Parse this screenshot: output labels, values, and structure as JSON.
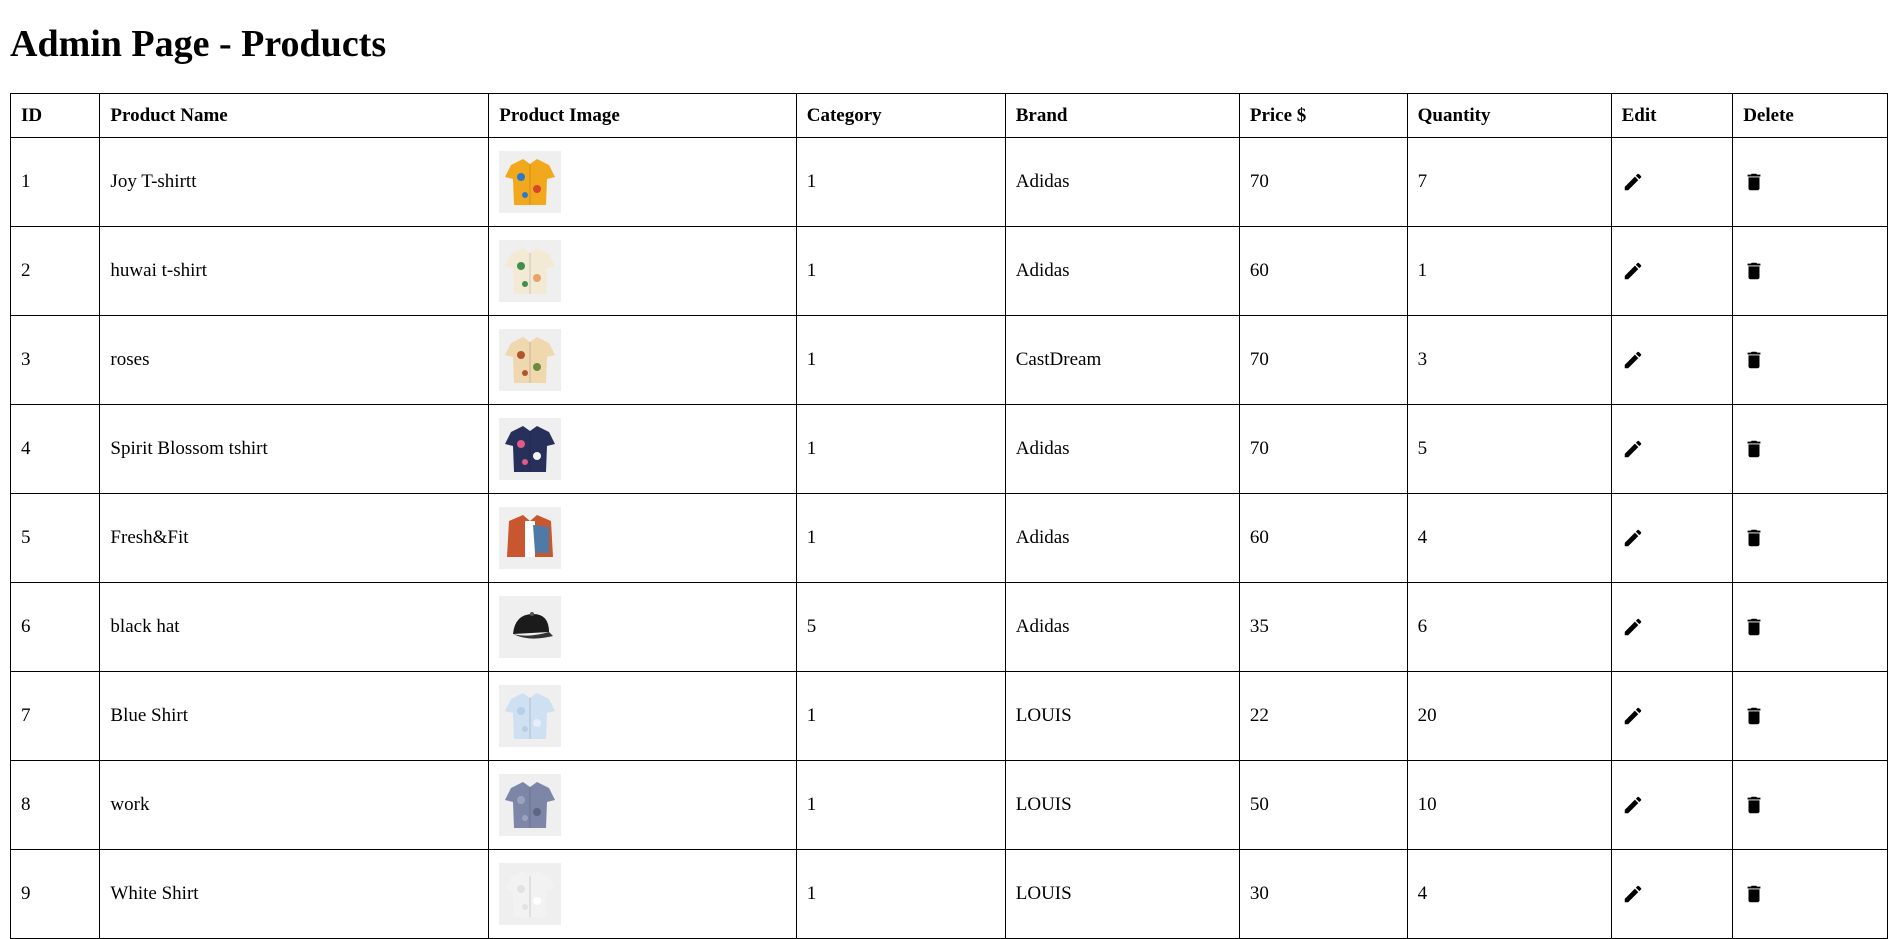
{
  "page_title": "Admin Page - Products",
  "table": {
    "headers": [
      "ID",
      "Product Name",
      "Product Image",
      "Category",
      "Brand",
      "Price $",
      "Quantity",
      "Edit",
      "Delete"
    ],
    "rows": [
      {
        "id": "1",
        "name": "Joy T-shirtt",
        "image": "colorful-print-shirt",
        "category": "1",
        "brand": "Adidas",
        "price": "70",
        "quantity": "7"
      },
      {
        "id": "2",
        "name": "huwai t-shirt",
        "image": "tropical-leaf-shirt",
        "category": "1",
        "brand": "Adidas",
        "price": "60",
        "quantity": "1"
      },
      {
        "id": "3",
        "name": "roses",
        "image": "rose-print-shirt",
        "category": "1",
        "brand": "CastDream",
        "price": "70",
        "quantity": "3"
      },
      {
        "id": "4",
        "name": "Spirit Blossom tshirt",
        "image": "navy-floral-shirt",
        "category": "1",
        "brand": "Adidas",
        "price": "70",
        "quantity": "5"
      },
      {
        "id": "5",
        "name": "Fresh&Fit",
        "image": "layered-jacket-outfit",
        "category": "1",
        "brand": "Adidas",
        "price": "60",
        "quantity": "4"
      },
      {
        "id": "6",
        "name": "black hat",
        "image": "black-cap",
        "category": "5",
        "brand": "Adidas",
        "price": "35",
        "quantity": "6"
      },
      {
        "id": "7",
        "name": "Blue Shirt",
        "image": "light-blue-dress-shirt",
        "category": "1",
        "brand": "LOUIS",
        "price": "22",
        "quantity": "20"
      },
      {
        "id": "8",
        "name": "work",
        "image": "striped-work-shirt",
        "category": "1",
        "brand": "LOUIS",
        "price": "50",
        "quantity": "10"
      },
      {
        "id": "9",
        "name": "White Shirt",
        "image": "white-dress-shirt",
        "category": "1",
        "brand": "LOUIS",
        "price": "30",
        "quantity": "4"
      }
    ]
  },
  "icons": {
    "edit": "pencil-icon",
    "delete": "trash-icon"
  }
}
